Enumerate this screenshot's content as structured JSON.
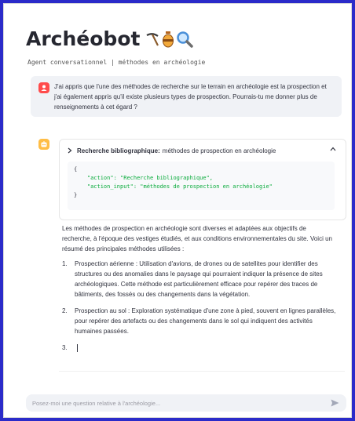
{
  "app": {
    "title": "Archéobot",
    "subtitle": "Agent conversationnel | méthodes en archéologie"
  },
  "messages": {
    "user": "J'ai appris que l'une des méthodes de recherche sur le terrain en archéologie est la prospection et j'ai également appris qu'il existe plusieurs types de prospection. Pourrais-tu me donner plus de renseignements à cet égard ?"
  },
  "tool": {
    "label": "Recherche bibliographique:",
    "query": "méthodes de prospection en archéologie",
    "code_open": "{",
    "code_action_key": "\"action\":",
    "code_action_value": " \"Recherche bibliographique\",",
    "code_input_key": "\"action_input\":",
    "code_input_value": " \"méthodes de prospection en archéologie\"",
    "code_close": "}"
  },
  "answer": {
    "intro": "Les méthodes de prospection en archéologie sont diverses et adaptées aux objectifs de recherche, à l'époque des vestiges étudiés, et aux conditions environnementales du site. Voici un résumé des principales méthodes utilisées :",
    "items": [
      {
        "num": "1.",
        "text": "Prospection aérienne : Utilisation d'avions, de drones ou de satellites pour identifier des structures ou des anomalies dans le paysage qui pourraient indiquer la présence de sites archéologiques. Cette méthode est particulièrement efficace pour repérer des traces de bâtiments, des fossés ou des changements dans la végétation."
      },
      {
        "num": "2.",
        "text": "Prospection au sol : Exploration systématique d'une zone à pied, souvent en lignes parallèles, pour repérer des artefacts ou des changements dans le sol qui indiquent des activités humaines passées."
      },
      {
        "num": "3.",
        "text": ""
      }
    ]
  },
  "chat_input": {
    "placeholder": "Posez-moi une question relative à l'archéologie..."
  },
  "colors": {
    "user_avatar": "#ff4b4b",
    "bot_avatar": "#ffbd45",
    "background_border": "#2b2bc9"
  },
  "icons": [
    "pickaxe-icon",
    "amphora-icon",
    "magnifier-icon",
    "user-avatar-icon",
    "bot-avatar-icon",
    "chevron-right-icon",
    "chevron-up-icon",
    "send-icon"
  ]
}
